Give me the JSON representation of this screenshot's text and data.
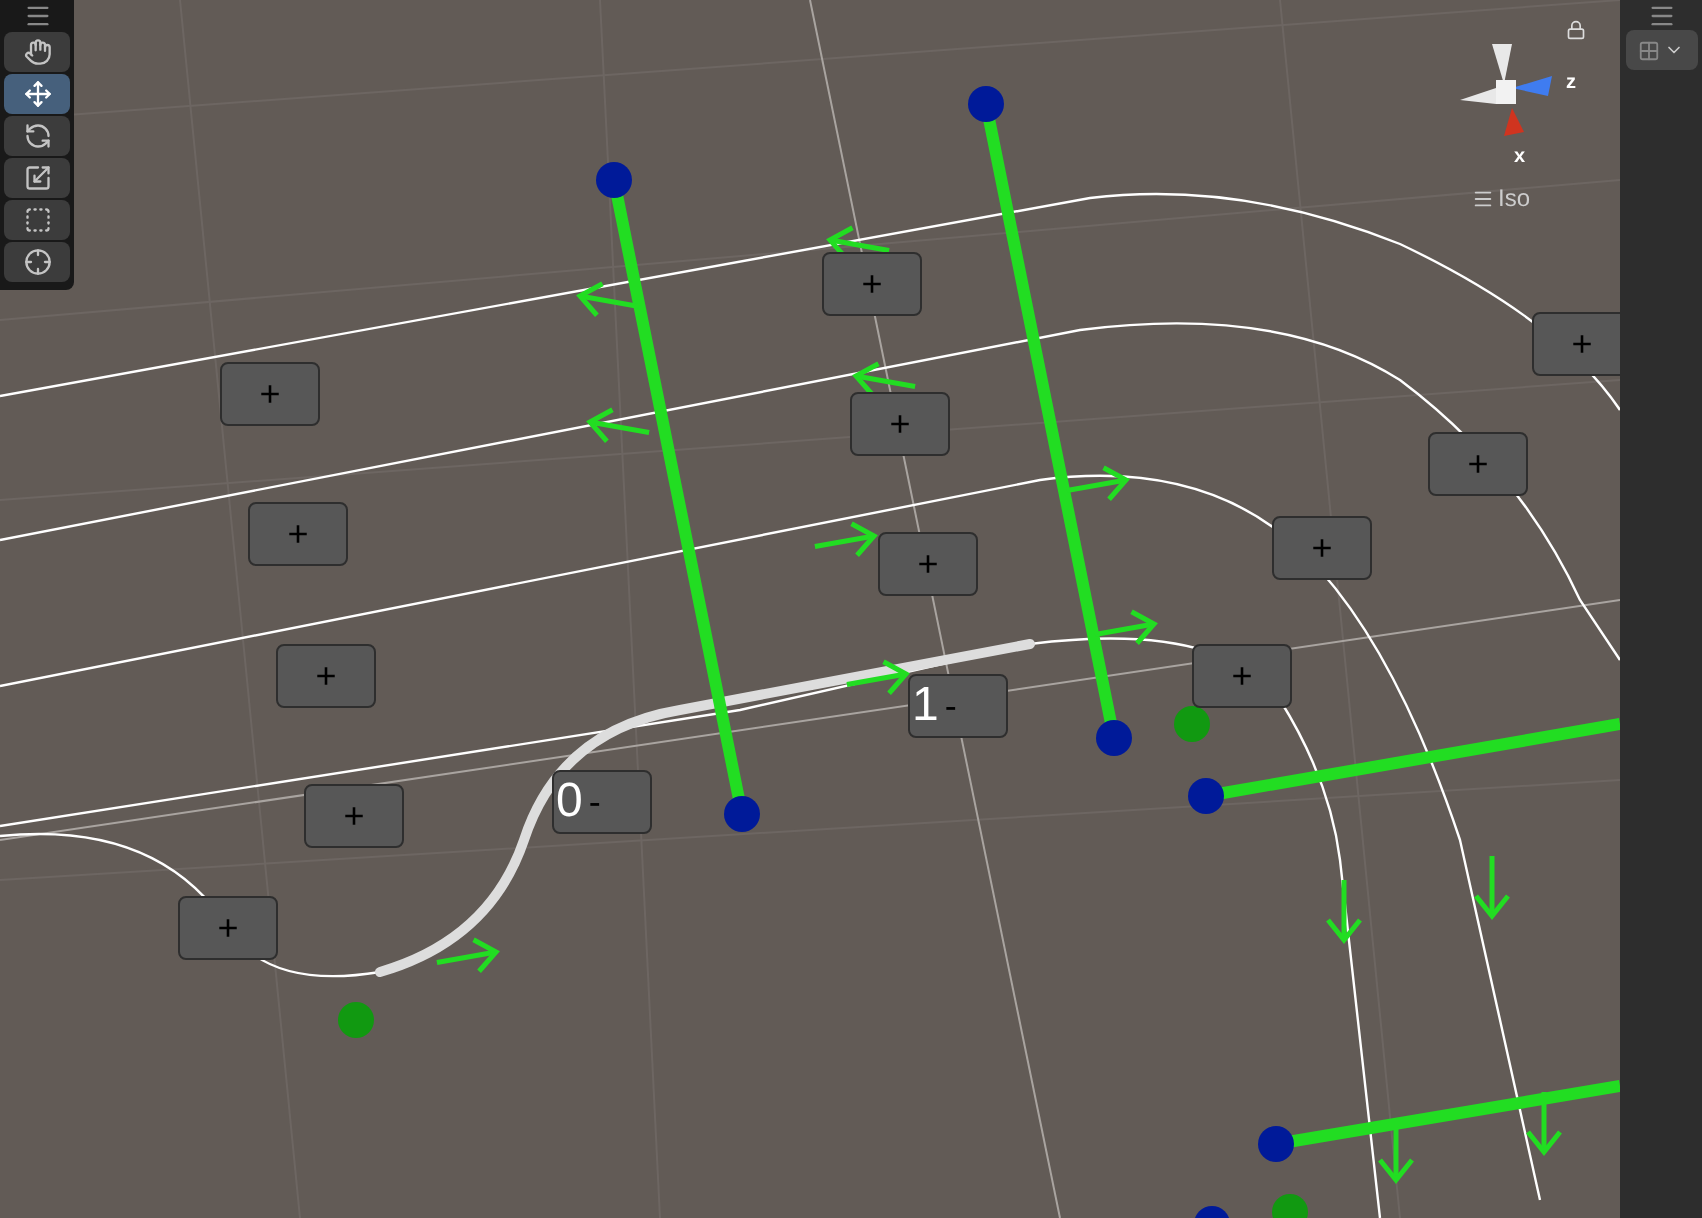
{
  "toolbar": {
    "tools": [
      {
        "selected": false
      },
      {
        "selected": true
      },
      {
        "selected": false
      },
      {
        "selected": false
      },
      {
        "selected": false
      },
      {
        "selected": false
      }
    ]
  },
  "orientation_gizmo": {
    "axis_labels": [
      "z",
      "x"
    ],
    "projection": "Iso"
  },
  "add_buttons": [
    "+",
    "+",
    "+",
    "+",
    "+",
    "+",
    "+",
    "+",
    "+",
    "+",
    "+",
    "+"
  ],
  "node_labels": [
    {
      "index": "0",
      "remove": "-"
    },
    {
      "index": "1",
      "remove": "-"
    }
  ]
}
